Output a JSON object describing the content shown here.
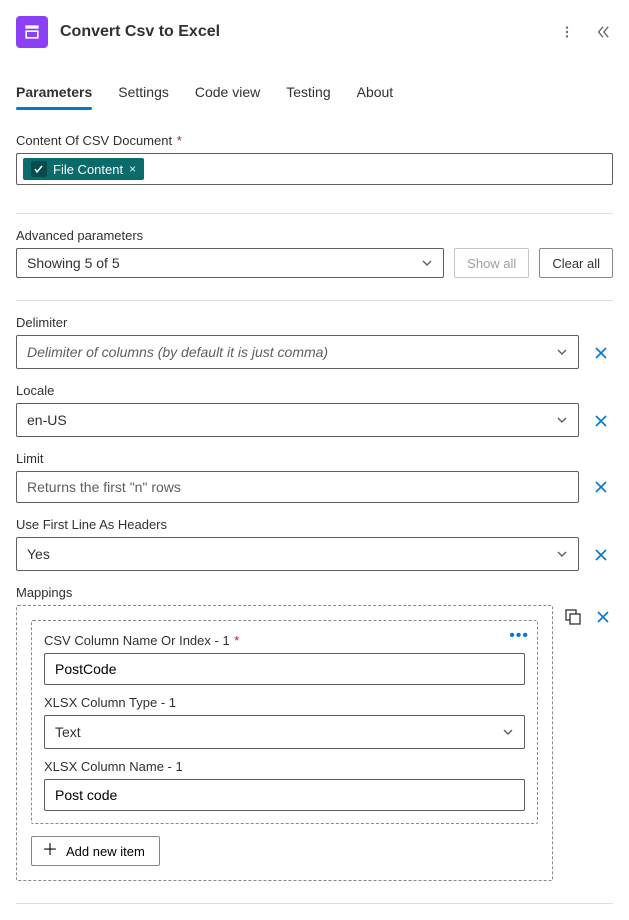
{
  "header": {
    "title": "Convert Csv to Excel"
  },
  "tabs": {
    "parameters": "Parameters",
    "settings": "Settings",
    "code_view": "Code view",
    "testing": "Testing",
    "about": "About"
  },
  "fields": {
    "content_label": "Content Of CSV Document",
    "file_content_token": "File Content",
    "advanced_label": "Advanced parameters",
    "advanced_select": "Showing 5 of 5",
    "show_all": "Show all",
    "clear_all": "Clear all",
    "delimiter_label": "Delimiter",
    "delimiter_placeholder": "Delimiter of columns (by default it is just comma)",
    "locale_label": "Locale",
    "locale_value": "en-US",
    "limit_label": "Limit",
    "limit_placeholder": "Returns the first \"n\" rows",
    "headers_label": "Use First Line As Headers",
    "headers_value": "Yes",
    "mappings_label": "Mappings",
    "add_new_item": "Add new item"
  },
  "mapping_item": {
    "csv_col_label": "CSV Column Name Or Index - 1",
    "csv_col_value": "PostCode",
    "xlsx_type_label": "XLSX Column Type - 1",
    "xlsx_type_value": "Text",
    "xlsx_name_label": "XLSX Column Name - 1",
    "xlsx_name_value": "Post code"
  }
}
